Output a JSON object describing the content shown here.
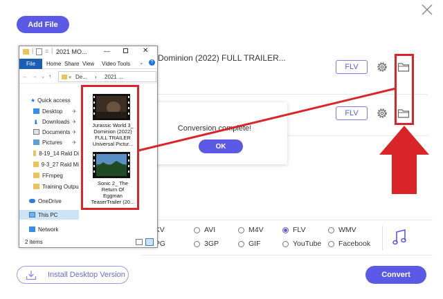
{
  "app": {
    "add_file_label": "Add File",
    "rows": [
      {
        "title": "Dominion (2022) FULL TRAILER...",
        "format": "FLV"
      },
      {
        "title": "",
        "format": "FLV"
      }
    ],
    "popup": {
      "message": "Conversion complete!",
      "ok_label": "OK"
    },
    "formats": {
      "row1": [
        {
          "label": "MKV",
          "selected": false
        },
        {
          "label": "AVI",
          "selected": false
        },
        {
          "label": "M4V",
          "selected": false
        },
        {
          "label": "FLV",
          "selected": true
        },
        {
          "label": "WMV",
          "selected": false
        }
      ],
      "row2": [
        {
          "label": "MPG",
          "selected": false
        },
        {
          "label": "3GP",
          "selected": false
        },
        {
          "label": "GIF",
          "selected": false
        },
        {
          "label": "YouTube",
          "selected": false
        },
        {
          "label": "Facebook",
          "selected": false
        }
      ]
    },
    "install_label": "Install Desktop Version",
    "convert_label": "Convert",
    "accent": "#5b5ae6",
    "annotation_color": "#d9242a"
  },
  "explorer": {
    "title": "2021 MO...",
    "ribbon_tabs": [
      "File",
      "Home",
      "Share",
      "View",
      "Video Tools"
    ],
    "address": {
      "part1": "De...",
      "sep": "›",
      "part2": "2021 ..."
    },
    "nav": [
      {
        "label": "Quick access",
        "icon": "star-icon"
      },
      {
        "label": "Desktop",
        "icon": "desktop-icon",
        "pinned": true
      },
      {
        "label": "Downloads",
        "icon": "download-icon",
        "pinned": true
      },
      {
        "label": "Documents",
        "icon": "documents-icon",
        "pinned": true
      },
      {
        "label": "Pictures",
        "icon": "pictures-icon",
        "pinned": true
      },
      {
        "label": "8-19_14 Rald Di",
        "icon": "folder-icon"
      },
      {
        "label": "9-3_27 Rald Mi",
        "icon": "folder-icon"
      },
      {
        "label": "FFmpeg",
        "icon": "folder-icon"
      },
      {
        "label": "Training Outpu",
        "icon": "folder-icon"
      },
      {
        "label": "OneDrive",
        "icon": "cloud-icon"
      },
      {
        "label": "This PC",
        "icon": "pc-icon"
      },
      {
        "label": "Network",
        "icon": "network-icon"
      }
    ],
    "files": [
      {
        "name_lines": [
          "Jurassic World 3_",
          "Dominion (2022)",
          "FULL TRAILER",
          "Universal Pictur..."
        ]
      },
      {
        "name_lines": [
          "Sonic 2_ The",
          "Return Of",
          "Eggman",
          "TeaserTrailer (20..."
        ]
      }
    ],
    "status": "2 items"
  }
}
